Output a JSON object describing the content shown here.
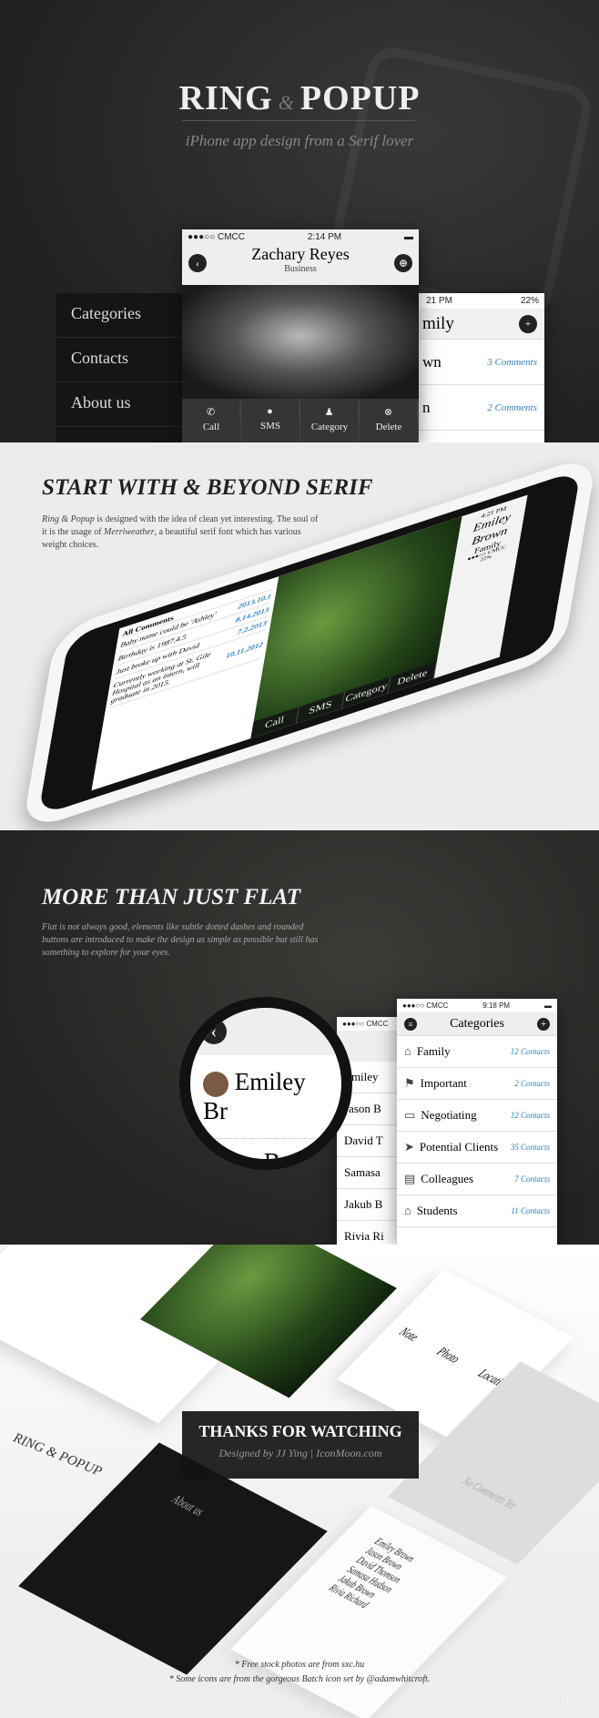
{
  "hero": {
    "title_left": "RING",
    "amp": "&",
    "title_right": "POPUP",
    "subtitle": "iPhone app design from a Serif lover",
    "menu": [
      "Categories",
      "Contacts",
      "About us"
    ],
    "contact_card": {
      "carrier": "●●●○○ CMCC",
      "time": "2:14 PM",
      "name": "Zachary Reyes",
      "group": "Business",
      "actions": [
        "Call",
        "SMS",
        "Category",
        "Delete"
      ]
    },
    "family_card": {
      "time": "21 PM",
      "battery": "22%",
      "title": "mily",
      "rows": [
        {
          "name": "wn",
          "count": "3 Comments"
        },
        {
          "name": "n",
          "count": "2 Comments"
        }
      ]
    }
  },
  "serif": {
    "title": "START WITH & BEYOND SERIF",
    "p1_em": "Ring & Popup",
    "p1": " is designed with the idea of clean yet interesting. The soul of it is the usage of ",
    "p1_em2": "Merriweather",
    "p1_end": ", a beautiful serif font which has various weight choices.",
    "phone": {
      "name": "Emiley Brown",
      "group": "Family",
      "carrier": "●●●○○ CMCC",
      "time": "4:21 PM",
      "battery": "22%",
      "actions": [
        "Call",
        "SMS",
        "Category",
        "Delete"
      ],
      "comments_header": "All Comments",
      "comments": [
        {
          "text": "Baby name could be 'Ashley'",
          "date": "2013.10.1"
        },
        {
          "text": "Birthday is 1987.4.5",
          "date": "8.14.2013"
        },
        {
          "text": "Just broke up with David",
          "date": "7.2.2013"
        },
        {
          "text": "Currently working at St. Gile Hospital as an intern, will graduate in 2015.",
          "date": "10.11.2012"
        }
      ]
    }
  },
  "flat": {
    "title": "MORE THAN JUST FLAT",
    "paragraph": "Flat is not always good, elements like subtle dotted dashes and rounded buttons are introduced to  make the design as simple as possible but still has something to explore for your eyes.",
    "magnifier": {
      "names": [
        "Emiley Br",
        "Jason B"
      ]
    },
    "contacts": {
      "carrier": "●●●○○ CMCC",
      "names": [
        "Emiley",
        "Jason B",
        "David T",
        "Samasa",
        "Jakub B",
        "Rivia Ri"
      ]
    },
    "categories": {
      "carrier": "●●●○○ CMCC",
      "time": "9:18 PM",
      "title": "Categories",
      "items": [
        {
          "icon": "home",
          "label": "Family",
          "count": "12 Contacts"
        },
        {
          "icon": "flag",
          "label": "Important",
          "count": "2 Contacts"
        },
        {
          "icon": "chat",
          "label": "Negotiating",
          "count": "12 Contacts"
        },
        {
          "icon": "send",
          "label": "Potential Clients",
          "count": "35 Contacts"
        },
        {
          "icon": "store",
          "label": "Colleagues",
          "count": "7 Contacts"
        },
        {
          "icon": "bank",
          "label": "Students",
          "count": "11 Contacts"
        }
      ]
    }
  },
  "outro": {
    "thanks": "THANKS FOR WATCHING",
    "credit": "Designed by JJ Ying  |  IconMoon.com",
    "logo": "RING & POPUP",
    "about": "About us",
    "family": [
      "Emiley Brown",
      "Jason Brown",
      "David Thomson",
      "Samasa Hudson",
      "Jakub Brown",
      "Rivia Richard"
    ],
    "note_actions": [
      "Note",
      "Photo",
      "Location"
    ],
    "no_comments": "No Comments Yet",
    "footnote1": "* Free stock photos are from sxc.hu",
    "footnote2": "* Some icons are from the gorgeous Batch icon set by @adamwhitcroft.",
    "watermark": "Tuyiyi.com"
  },
  "colors": {
    "accent": "#2b7fc8",
    "dark": "#232220"
  }
}
